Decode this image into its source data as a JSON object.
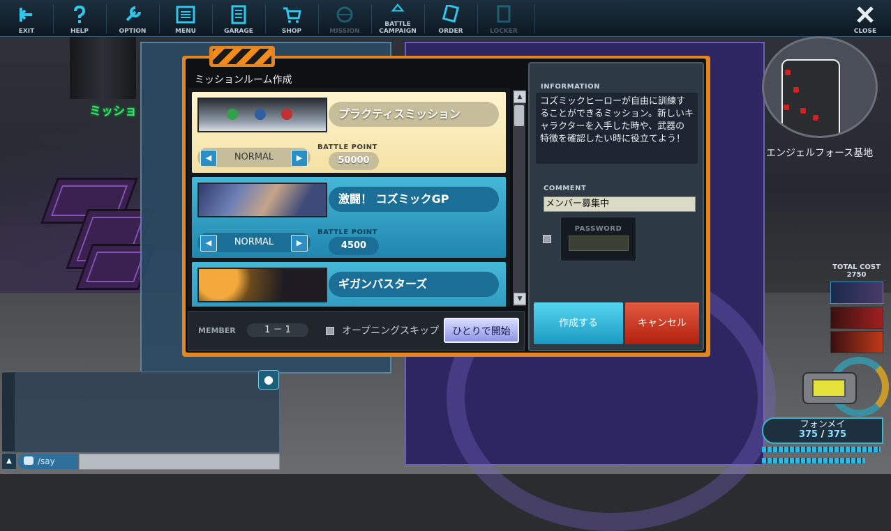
{
  "toolbar": {
    "items": [
      {
        "label": "EXIT",
        "icon": "exit-icon"
      },
      {
        "label": "HELP",
        "icon": "help-icon"
      },
      {
        "label": "OPTION",
        "icon": "wrench-icon"
      },
      {
        "label": "MENU",
        "icon": "menu-icon"
      },
      {
        "label": "GARAGE",
        "icon": "garage-icon"
      },
      {
        "label": "SHOP",
        "icon": "cart-icon"
      },
      {
        "label": "MISSION",
        "icon": "mission-icon"
      },
      {
        "label": "BATTLE CAMPAIGN",
        "icon": "battle-campaign-icon"
      },
      {
        "label": "ORDER",
        "icon": "order-icon"
      },
      {
        "label": "LOCKER",
        "icon": "locker-icon"
      }
    ],
    "close_label": "CLOSE"
  },
  "scene": {
    "zone_text": "ミッショ"
  },
  "minimap": {
    "base_name": "エンジェルフォース基地"
  },
  "hud": {
    "total_cost_label": "TOTAL COST",
    "total_cost_value": "2750",
    "player_name": "フォンメイ",
    "hp_current": "375",
    "hp_separator": "/",
    "hp_max": "375"
  },
  "chat": {
    "mode_label": "/say",
    "input_value": ""
  },
  "dialog": {
    "title": "ミッションルーム作成",
    "missions": [
      {
        "name": "プラクティスミッション",
        "difficulty": "NORMAL",
        "bp_label": "BATTLE POINT",
        "bp": "50000",
        "selected": true
      },
      {
        "name": "激闘！ コズミックGP",
        "difficulty": "NORMAL",
        "bp_label": "BATTLE POINT",
        "bp": "4500",
        "selected": false
      },
      {
        "name": "ギガンバスターズ",
        "difficulty": "",
        "bp_label": "",
        "bp": "",
        "selected": false
      }
    ],
    "member_label": "MEMBER",
    "member_value": "1 － 1",
    "opening_skip_label": "オープニングスキップ",
    "opening_skip_checked": false,
    "solo_start_label": "ひとりで開始",
    "info_heading": "INFORMATION",
    "info_text": "コズミックヒーローが自由に訓練することができるミッション。新しいキャラクターを入手した時や、武器の特徴を確認したい時に役立てよう！",
    "comment_heading": "COMMENT",
    "comment_value": "メンバー募集中",
    "password_heading": "PASSWORD",
    "password_checked": false,
    "create_label": "作成する",
    "cancel_label": "キャンセル"
  },
  "colors": {
    "accent_orange": "#e58520",
    "selected_card": "#f4e2a4",
    "card_blue": "#2086ae",
    "create": "#1a9ac2",
    "cancel": "#b2200e"
  }
}
